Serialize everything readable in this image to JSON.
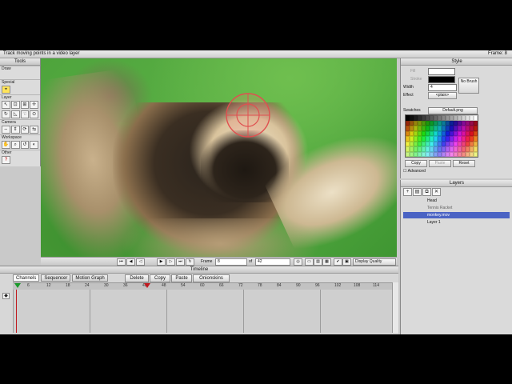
{
  "window": {
    "title": "Track moving points in a video layer",
    "frame_label": "Frame: 8"
  },
  "tools": {
    "title": "Tools",
    "sections": [
      "Draw",
      "Special",
      "Layer",
      "Camera",
      "Workspace",
      "Other"
    ]
  },
  "viewer": {
    "frame_label": "Frame",
    "frame_value": "8",
    "of_label": "of",
    "total_frames": "42",
    "quality": "Display Quality"
  },
  "style": {
    "title": "Style",
    "fill_label": "Fill",
    "stroke_label": "Stroke",
    "width_label": "Width",
    "width_value": "4",
    "effect_label": "Effect",
    "effect_value": "<plain>",
    "no_brush": "No Brush",
    "swatches_label": "Swatches",
    "swatches_value": "Default.png",
    "copy": "Copy",
    "paste": "Paste",
    "reset": "Reset",
    "advanced": "Advanced",
    "fill_color": "#ffffff",
    "stroke_color": "#000000"
  },
  "layers": {
    "title": "Layers",
    "items": [
      {
        "name": "Head"
      },
      {
        "name": "Tennis Racket"
      },
      {
        "name": "monkey.mov"
      },
      {
        "name": "Layer 1"
      }
    ],
    "selected_index": 2
  },
  "timeline": {
    "title": "Timeline",
    "tabs": [
      "Channels",
      "Sequencer",
      "Motion Graph"
    ],
    "active_tab": 0,
    "delete": "Delete",
    "copy": "Copy",
    "paste": "Paste",
    "onionskins": "Onionskins",
    "ticks": [
      "6",
      "12",
      "18",
      "24",
      "30",
      "36",
      "42",
      "48",
      "54",
      "60",
      "66",
      "72",
      "78",
      "84",
      "90",
      "96",
      "102",
      "108",
      "114"
    ]
  },
  "colors": {
    "selection": "#4a63c4",
    "target": "#e05050"
  }
}
